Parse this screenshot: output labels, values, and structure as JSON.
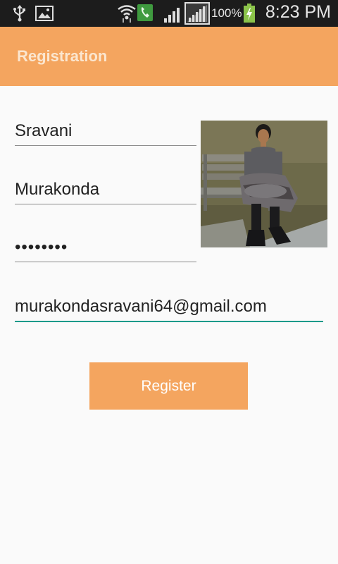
{
  "status_bar": {
    "battery_percent": "100%",
    "time": "8:23 PM",
    "icons": [
      "usb-icon",
      "image-icon",
      "wifi-icon",
      "phone-call-icon",
      "signal-icon",
      "signal-icon-2",
      "battery-charging-icon"
    ]
  },
  "app_bar": {
    "title": "Registration",
    "color": "#f4a55f"
  },
  "form": {
    "first_name": "Sravani",
    "last_name": "Murakonda",
    "password": "••••••••",
    "email": "murakondasravani64@gmail.com"
  },
  "register_button": {
    "label": "Register"
  },
  "colors": {
    "accent": "#f4a55f",
    "focus_underline": "#1b9a8a"
  }
}
